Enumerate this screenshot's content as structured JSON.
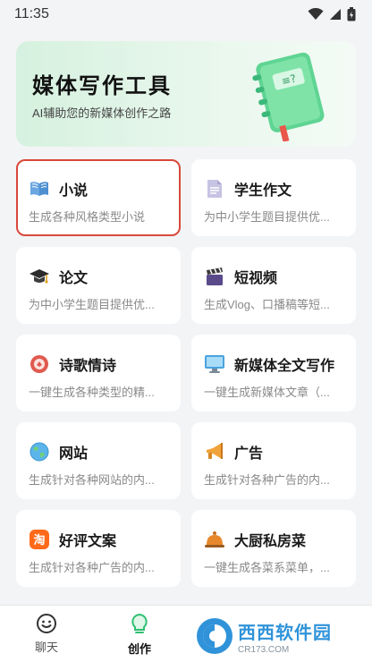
{
  "status_bar": {
    "time": "11:35"
  },
  "banner": {
    "title": "媒体写作工具",
    "subtitle": "AI辅助您的新媒体创作之路"
  },
  "cards": [
    {
      "title": "小说",
      "desc": "生成各种风格类型小说",
      "icon": "book-icon",
      "selected": true
    },
    {
      "title": "学生作文",
      "desc": "为中小学生题目提供优...",
      "icon": "document-icon"
    },
    {
      "title": "论文",
      "desc": "为中小学生题目提供优...",
      "icon": "graduation-cap-icon"
    },
    {
      "title": "短视频",
      "desc": "生成Vlog、口播稿等短...",
      "icon": "clapperboard-icon"
    },
    {
      "title": "诗歌情诗",
      "desc": "一键生成各种类型的精...",
      "icon": "poetry-icon"
    },
    {
      "title": "新媒体全文写作",
      "desc": "一键生成新媒体文章（...",
      "icon": "monitor-icon"
    },
    {
      "title": "网站",
      "desc": "生成针对各种网站的内...",
      "icon": "globe-icon"
    },
    {
      "title": "广告",
      "desc": "生成针对各种广告的内...",
      "icon": "megaphone-icon"
    },
    {
      "title": "好评文案",
      "desc": "生成针对各种广告的内...",
      "icon": "taobao-icon"
    },
    {
      "title": "大厨私房菜",
      "desc": "一键生成各菜系菜单，...",
      "icon": "service-bell-icon"
    }
  ],
  "tabs": [
    {
      "label": "聊天",
      "icon": "chat-smile-icon"
    },
    {
      "label": "创作",
      "icon": "lightbulb-icon",
      "active": true
    }
  ],
  "watermark": {
    "brand": "西西软件园",
    "url": "CR173.COM"
  },
  "colors": {
    "accent_green": "#3cc47c",
    "selected_border": "#d9483b"
  }
}
